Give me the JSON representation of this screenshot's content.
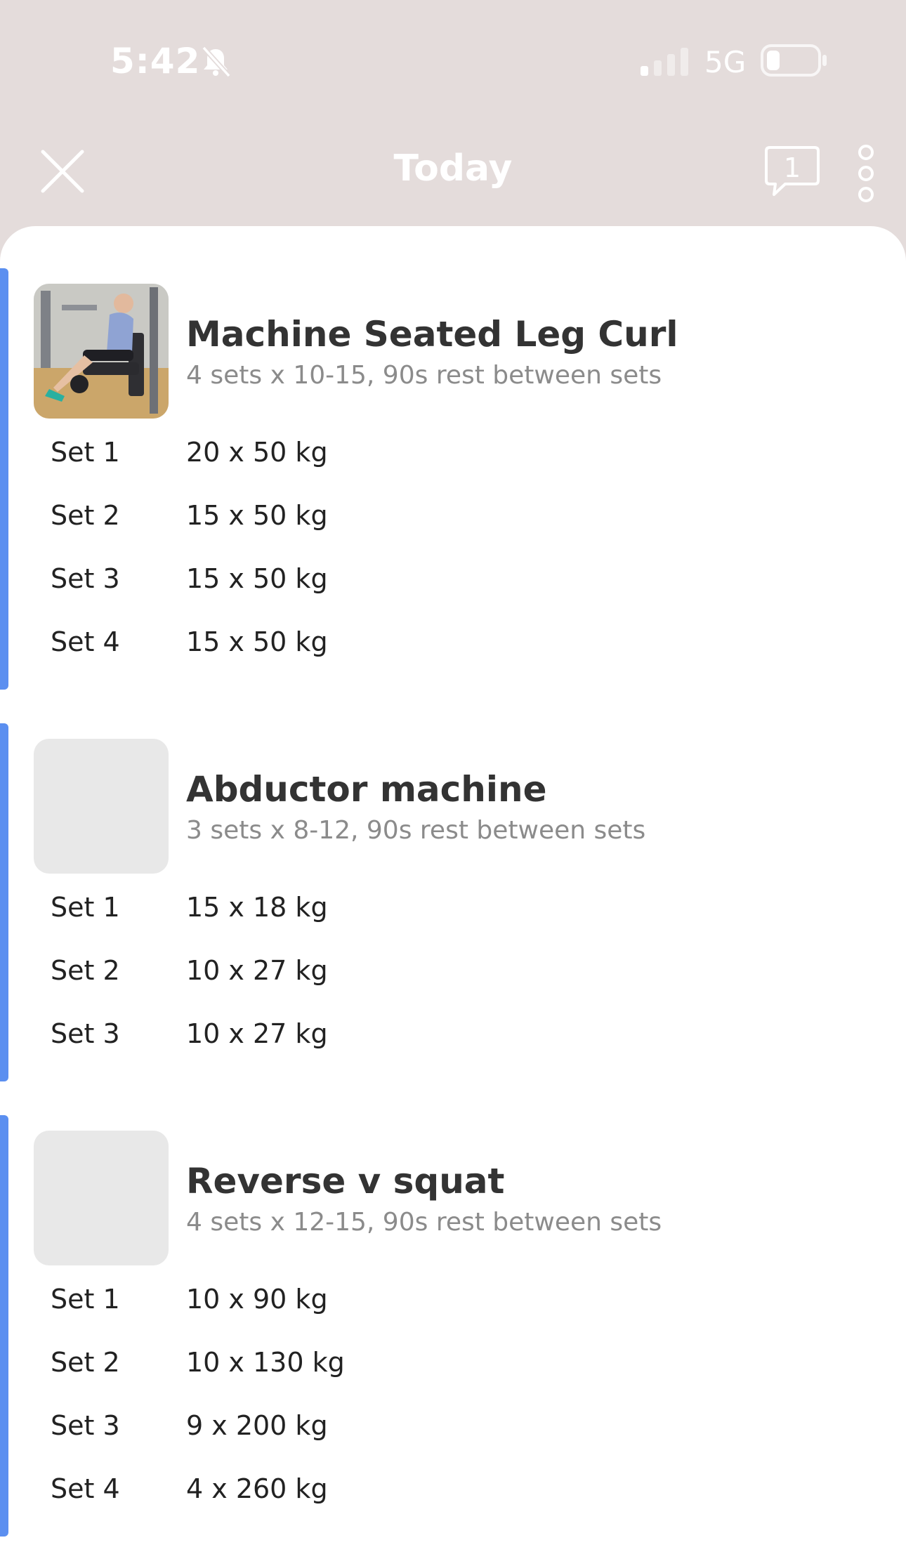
{
  "status": {
    "time": "5:42",
    "network": "5G"
  },
  "nav": {
    "title": "Today",
    "comment_count": "1"
  },
  "colors": {
    "accent": "#5b8ff0",
    "header_bg": "#e4dcdb"
  },
  "icons": [
    "bell-slash-icon",
    "signal-icon",
    "battery-icon",
    "close-icon",
    "comment-icon",
    "more-vertical-icon"
  ],
  "exercises": [
    {
      "title": "Machine Seated Leg Curl",
      "subtitle": "4 sets x 10-15, 90s rest between sets",
      "has_image": true,
      "sets": [
        {
          "label": "Set 1",
          "value": "20 x 50 kg"
        },
        {
          "label": "Set 2",
          "value": "15 x 50 kg"
        },
        {
          "label": "Set 3",
          "value": "15 x 50 kg"
        },
        {
          "label": "Set 4",
          "value": "15 x 50 kg"
        }
      ]
    },
    {
      "title": "Abductor machine",
      "subtitle": "3 sets x 8-12, 90s rest between sets",
      "has_image": false,
      "sets": [
        {
          "label": "Set 1",
          "value": "15 x 18 kg"
        },
        {
          "label": "Set 2",
          "value": "10 x 27 kg"
        },
        {
          "label": "Set 3",
          "value": "10 x 27 kg"
        }
      ]
    },
    {
      "title": "Reverse v squat",
      "subtitle": "4 sets x 12-15, 90s rest between sets",
      "has_image": false,
      "sets": [
        {
          "label": "Set 1",
          "value": "10 x 90 kg"
        },
        {
          "label": "Set 2",
          "value": "10 x 130 kg"
        },
        {
          "label": "Set 3",
          "value": "9 x 200 kg"
        },
        {
          "label": "Set 4",
          "value": "4 x 260 kg"
        }
      ]
    }
  ]
}
